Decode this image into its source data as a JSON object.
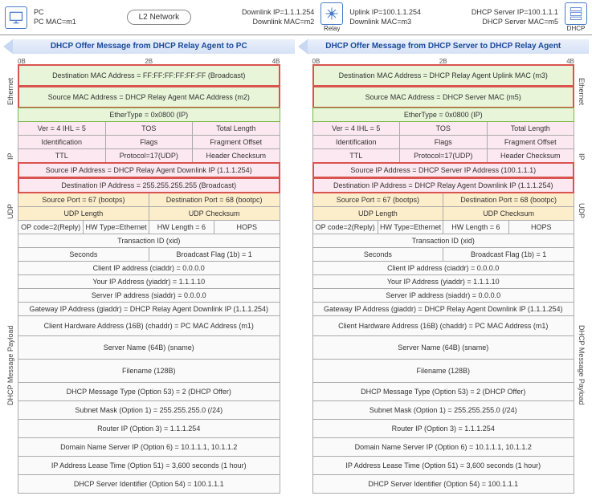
{
  "top": {
    "pc": "PC",
    "pcmac": "PC MAC=m1",
    "l2": "L2 Network",
    "dl_ip": "Downlink IP=1.1.1.254",
    "dl_mac": "Downlink MAC=m2",
    "relay": "Relay",
    "ul_ip": "Uplink IP=100.1.1.254",
    "ul_mac": "Downlink MAC=m3",
    "srv_ip": "DHCP Server IP=100.1.1.1",
    "srv_mac": "DHCP Server MAC=m5",
    "dhcp": "DHCP"
  },
  "left": {
    "title": "DHCP Offer Message from DHCP Relay Agent to PC",
    "r0": "0B",
    "r2": "2B",
    "r4": "4B",
    "eth": {
      "dst": "Destination MAC Address = FF:FF:FF:FF:FF:FF (Broadcast)",
      "src": "Source MAC Address = DHCP Relay Agent MAC Address (m2)",
      "type": "EtherType = 0x0800 (IP)",
      "lbl": "Ethernet"
    },
    "ip": {
      "a": "Ver = 4   IHL = 5",
      "b": "TOS",
      "c": "Total Length",
      "d": "Identification",
      "e": "Flags",
      "f": "Fragment Offset",
      "g": "TTL",
      "h": "Protocol=17(UDP)",
      "i": "Header Checksum",
      "src": "Source IP Address = DHCP Relay Agent Downlink IP (1.1.1.254)",
      "dst": "Destination IP Address = 255.255.255.255 (Broadcast)",
      "lbl": "IP"
    },
    "udp": {
      "sp": "Source Port = 67 (bootps)",
      "dp": "Destination Port = 68 (bootpc)",
      "len": "UDP Length",
      "ck": "UDP Checksum",
      "lbl": "UDP"
    },
    "pay": {
      "lbl": "DHCP Message Payload",
      "a": "OP code=2(Reply)",
      "b": "HW Type=Ethernet",
      "c": "HW Length = 6",
      "d": "HOPS",
      "xid": "Transaction ID (xid)",
      "sec": "Seconds",
      "flag": "Broadcast Flag (1b) = 1",
      "ci": "Client IP address (ciaddr) = 0.0.0.0",
      "yi": "Your IP Address (yiaddr) = 1.1.1.10",
      "si": "Server IP address (siaddr) = 0.0.0.0",
      "gi": "Gateway IP Address (giaddr) = DHCP Relay Agent Downlink IP (1.1.1.254)",
      "ch": "Client Hardware Address (16B) (chaddr) = PC MAC Address (m1)",
      "sn": "Server Name (64B) (sname)",
      "fn": "Filename (128B)",
      "o53": "DHCP Message Type (Option 53) = 2 (DHCP Offer)",
      "o1": "Subnet Mask (Option 1) = 255.255.255.0 (/24)",
      "o3": "Router IP (Option 3) = 1.1.1.254",
      "o6": "Domain Name Server IP (Option 6) = 10.1.1.1, 10.1.1.2",
      "o51": "IP Address Lease Time (Option 51) = 3,600 seconds (1 hour)",
      "o54": "DHCP Server Identifier (Option 54) = 100.1.1.1"
    }
  },
  "right": {
    "title": "DHCP Offer Message from DHCP Server to DHCP Relay Agent",
    "r0": "0B",
    "r2": "2B",
    "r4": "4B",
    "eth": {
      "dst": "Destination MAC Address = DHCP Relay Agent Uplink MAC (m3)",
      "src": "Source MAC Address = DHCP Server MAC (m5)",
      "type": "EtherType = 0x0800 (IP)",
      "lbl": "Ethernet"
    },
    "ip": {
      "a": "Ver = 4   IHL = 5",
      "b": "TOS",
      "c": "Total Length",
      "d": "Identification",
      "e": "Flags",
      "f": "Fragment Offset",
      "g": "TTL",
      "h": "Protocol=17(UDP)",
      "i": "Header Checksum",
      "src": "Source IP Address = DHCP Server IP Address (100.1.1.1)",
      "dst": "Destination IP Address = DHCP Relay Agent Downlink IP (1.1.1.254)",
      "lbl": "IP"
    },
    "udp": {
      "sp": "Source Port = 67 (bootps)",
      "dp": "Destination Port = 68 (bootpc)",
      "len": "UDP Length",
      "ck": "UDP Checksum",
      "lbl": "UDP"
    },
    "pay": {
      "lbl": "DHCP Message Payload",
      "a": "OP code=2(Reply)",
      "b": "HW Type=Ethernet",
      "c": "HW Length = 6",
      "d": "HOPS",
      "xid": "Transaction ID (xid)",
      "sec": "Seconds",
      "flag": "Broadcast Flag (1b) = 1",
      "ci": "Client IP address (ciaddr) = 0.0.0.0",
      "yi": "Your IP Address (yiaddr) = 1.1.1.10",
      "si": "Server IP address (siaddr) = 0.0.0.0",
      "gi": "Gateway IP Address (giaddr) = DHCP Relay Agent Downlink IP (1.1.1.254)",
      "ch": "Client Hardware Address (16B) (chaddr) = PC MAC Address (m1)",
      "sn": "Server Name (64B) (sname)",
      "fn": "Filename (128B)",
      "o53": "DHCP Message Type (Option 53) = 2 (DHCP Offer)",
      "o1": "Subnet Mask (Option 1) = 255.255.255.0 (/24)",
      "o3": "Router IP (Option 3) = 1.1.1.254",
      "o6": "Domain Name Server IP (Option 6) = 10.1.1.1, 10.1.1.2",
      "o51": "IP Address Lease Time (Option 51) = 3,600 seconds (1 hour)",
      "o54": "DHCP Server Identifier (Option 54) = 100.1.1.1"
    }
  }
}
